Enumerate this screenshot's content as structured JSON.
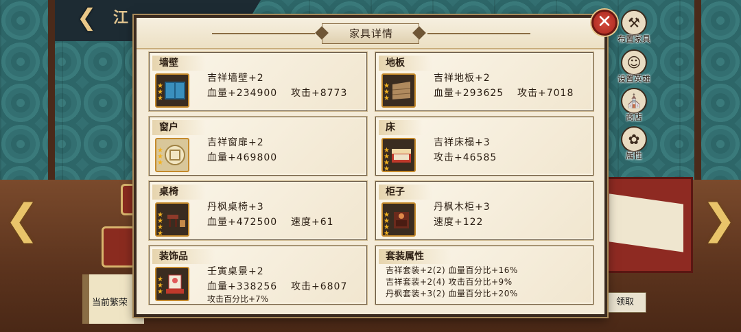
{
  "background": {
    "title": "江",
    "claim_button": "领取",
    "status_text": "当前繁荣"
  },
  "side_menu": [
    {
      "label": "布置家具",
      "icon": "table-icon"
    },
    {
      "label": "设置英雄",
      "icon": "hero-icon"
    },
    {
      "label": "商店",
      "icon": "shop-icon"
    },
    {
      "label": "属性",
      "icon": "attribute-icon"
    }
  ],
  "modal": {
    "title": "家具详情",
    "close_label": "✕"
  },
  "cards": [
    {
      "category": "墙壁",
      "name": "吉祥墙壁+2",
      "stats": [
        "血量+234900",
        "攻击+8773"
      ],
      "extra": "",
      "stars": 3
    },
    {
      "category": "地板",
      "name": "吉祥地板+2",
      "stats": [
        "血量+293625",
        "攻击+7018"
      ],
      "extra": "",
      "stars": 3
    },
    {
      "category": "窗户",
      "name": "吉祥窗扉+2",
      "stats": [
        "血量+469800",
        ""
      ],
      "extra": "",
      "stars": 3
    },
    {
      "category": "床",
      "name": "吉祥床榻+3",
      "stats": [
        "攻击+46585",
        ""
      ],
      "extra": "",
      "stars": 4
    },
    {
      "category": "桌椅",
      "name": "丹枫桌椅+3",
      "stats": [
        "血量+472500",
        "速度+61"
      ],
      "extra": "",
      "stars": 4
    },
    {
      "category": "柜子",
      "name": "丹枫木柜+3",
      "stats": [
        "速度+122",
        ""
      ],
      "extra": "",
      "stars": 4
    },
    {
      "category": "装饰品",
      "name": "壬寅桌景+2",
      "stats": [
        "血量+338256",
        "攻击+6807"
      ],
      "extra": "攻击百分比+7%",
      "stars": 3
    }
  ],
  "set_bonus": {
    "title": "套装属性",
    "lines": [
      "吉祥套装+2(2) 血量百分比+16%",
      "吉祥套装+2(4) 攻击百分比+9%",
      "丹枫套装+3(2) 血量百分比+20%"
    ]
  },
  "colors": {
    "panel": "#f4ebd8",
    "border": "#3a2a1e",
    "close": "#c0392b",
    "star": "#f4b320"
  }
}
